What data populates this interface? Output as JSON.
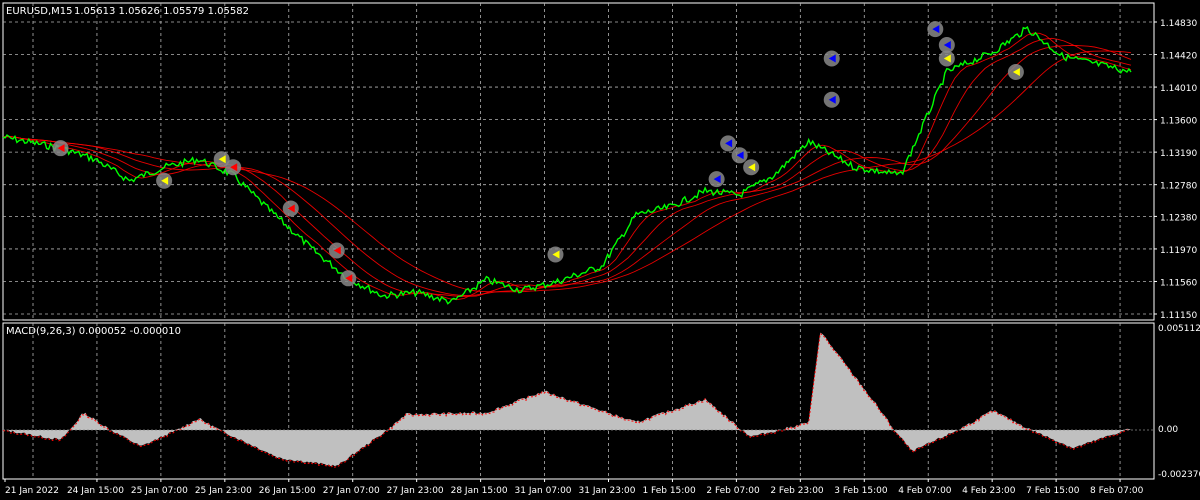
{
  "window": {
    "symbol_info": "EURUSD,M15",
    "ohlc": "1.05613 1.05626 1.05579 1.05582"
  },
  "indicator": {
    "label": "MACD(9,26,3) 0.000052 -0.000010",
    "scale_max": "0.005112",
    "scale_zero": "0.00",
    "scale_min": "-0.002376"
  },
  "colors": {
    "background": "#000000",
    "grid": "#b4b4b4",
    "price": "#00ff00",
    "moving_average": "#ff0000",
    "histogram": "#c0c0c0",
    "signal_line": "#ff0000",
    "marker_circle": "#888888",
    "marker_buy": "#0000ff",
    "marker_sell": "#ff0000",
    "marker_close": "#ffff00"
  },
  "price_axis_labels": [
    "1.14830",
    "1.14420",
    "1.14010",
    "1.13600",
    "1.13190",
    "1.12780",
    "1.12380",
    "1.11970",
    "1.11560",
    "1.11150"
  ],
  "time_axis_labels": [
    "21 Jan 2022",
    "24 Jan 15:00",
    "25 Jan 07:00",
    "25 Jan 23:00",
    "26 Jan 15:00",
    "27 Jan 07:00",
    "27 Jan 23:00",
    "28 Jan 15:00",
    "31 Jan 07:00",
    "31 Jan 23:00",
    "1 Feb 15:00",
    "2 Feb 07:00",
    "2 Feb 23:00",
    "3 Feb 15:00",
    "4 Feb 07:00",
    "4 Feb 23:00",
    "7 Feb 15:00",
    "8 Feb 07:00"
  ],
  "chart_data": {
    "type": "line",
    "series": [
      {
        "name": "EURUSD",
        "x": [
          0,
          5,
          8,
          11,
          14,
          17,
          20,
          23,
          27,
          30,
          33,
          36,
          39,
          42,
          45,
          48,
          52,
          55,
          58,
          61,
          64,
          67,
          70,
          74,
          78,
          82,
          86,
          89,
          92,
          95,
          98
        ],
        "y": [
          1.1338,
          1.1324,
          1.131,
          1.1283,
          1.13,
          1.131,
          1.129,
          1.1248,
          1.1195,
          1.116,
          1.1138,
          1.1142,
          1.113,
          1.1158,
          1.1145,
          1.1155,
          1.1175,
          1.124,
          1.125,
          1.127,
          1.1265,
          1.129,
          1.1332,
          1.13,
          1.129,
          1.142,
          1.1445,
          1.1475,
          1.144,
          1.143,
          1.142
        ]
      }
    ],
    "macd_histogram": [
      {
        "x": 0,
        "y": 0.0
      },
      {
        "x": 5,
        "y": -0.0006
      },
      {
        "x": 7,
        "y": 0.0009
      },
      {
        "x": 12,
        "y": -0.001
      },
      {
        "x": 17,
        "y": 0.0006
      },
      {
        "x": 24,
        "y": -0.0017
      },
      {
        "x": 29,
        "y": -0.0022
      },
      {
        "x": 35,
        "y": 0.0008
      },
      {
        "x": 42,
        "y": 0.0009
      },
      {
        "x": 47,
        "y": 0.002
      },
      {
        "x": 55,
        "y": 0.0004
      },
      {
        "x": 61,
        "y": 0.0016
      },
      {
        "x": 65,
        "y": -0.0004
      },
      {
        "x": 70,
        "y": 0.0004
      },
      {
        "x": 71,
        "y": 0.0051
      },
      {
        "x": 76,
        "y": 0.0012
      },
      {
        "x": 79,
        "y": -0.0013
      },
      {
        "x": 86,
        "y": 0.001
      },
      {
        "x": 93,
        "y": -0.0011
      },
      {
        "x": 98,
        "y": 0.0001
      }
    ],
    "yaxis_labels": [
      "1.14830",
      "1.14420",
      "1.14010",
      "1.13600",
      "1.13190",
      "1.12780",
      "1.12380",
      "1.11970",
      "1.11560",
      "1.11150"
    ],
    "macd_ylim": [
      -0.002376,
      0.005112
    ],
    "grid": true
  }
}
